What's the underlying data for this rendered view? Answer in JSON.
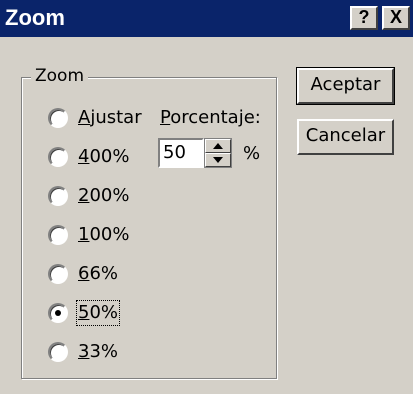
{
  "window": {
    "title": "Zoom",
    "help_label": "?",
    "close_label": "X"
  },
  "zoom_group": {
    "legend": "Zoom",
    "options": [
      {
        "prefix": "",
        "accel": "A",
        "rest": "justar",
        "selected": false
      },
      {
        "prefix": "",
        "accel": "4",
        "rest": "00%",
        "selected": false
      },
      {
        "prefix": "",
        "accel": "2",
        "rest": "00%",
        "selected": false
      },
      {
        "prefix": "",
        "accel": "1",
        "rest": "00%",
        "selected": false
      },
      {
        "prefix": "",
        "accel": "6",
        "rest": "6%",
        "selected": false
      },
      {
        "prefix": "",
        "accel": "5",
        "rest": "0%",
        "selected": true
      },
      {
        "prefix": "",
        "accel": "3",
        "rest": "3%",
        "selected": false
      }
    ],
    "percent": {
      "label_accel": "P",
      "label_rest": "orcentaje:",
      "value": "50",
      "unit": "%"
    }
  },
  "buttons": {
    "ok": "Aceptar",
    "cancel": "Cancelar"
  }
}
